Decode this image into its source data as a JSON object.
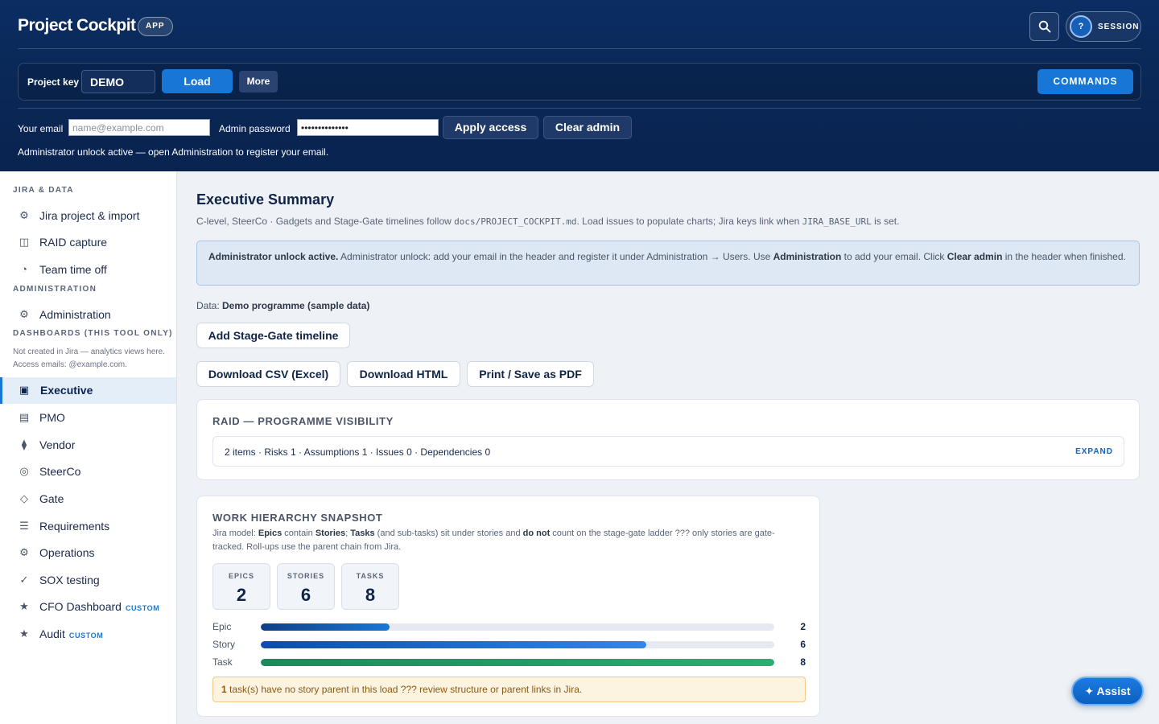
{
  "header": {
    "brand": "Project Cockpit",
    "app_badge": "APP",
    "session_initial": "?",
    "session_label": "SESSION",
    "toolbar": {
      "project_key_label": "Project key",
      "project_key_value": "DEMO",
      "load": "Load",
      "more": "More",
      "commands": "COMMANDS"
    },
    "access": {
      "email_label": "Your email",
      "email_placeholder": "name@example.com",
      "password_label": "Admin password",
      "password_value": "••••••••••••••",
      "apply": "Apply access",
      "clear": "Clear admin",
      "note": "Administrator unlock active — open Administration to register your email."
    }
  },
  "sidebar": {
    "sections": {
      "jira_data": "JIRA & DATA",
      "administration": "ADMINISTRATION",
      "dashboards": "DASHBOARDS (THIS TOOL ONLY)"
    },
    "dashboards_note": "Not created in Jira — analytics views here. Access emails: @example.com.",
    "items": [
      {
        "label": "Jira project & import",
        "icon": "gear-icon"
      },
      {
        "label": "RAID capture",
        "icon": "grid-icon"
      },
      {
        "label": "Team time off",
        "icon": "clock-icon"
      },
      {
        "label": "Administration",
        "icon": "gear-icon"
      },
      {
        "label": "Executive",
        "icon": "card-icon"
      },
      {
        "label": "PMO",
        "icon": "table-icon"
      },
      {
        "label": "Vendor",
        "icon": "diamond-icon"
      },
      {
        "label": "SteerCo",
        "icon": "target-icon"
      },
      {
        "label": "Gate",
        "icon": "diamond-outline-icon"
      },
      {
        "label": "Requirements",
        "icon": "list-icon"
      },
      {
        "label": "Operations",
        "icon": "gear-icon"
      },
      {
        "label": "SOX testing",
        "icon": "check-icon"
      },
      {
        "label": "CFO Dashboard",
        "icon": "star-icon",
        "tag": "CUSTOM"
      },
      {
        "label": "Audit",
        "icon": "star-icon",
        "tag": "CUSTOM"
      }
    ]
  },
  "main": {
    "title": "Executive Summary",
    "subtitle": {
      "p1": "C-level, SteerCo · Gadgets and Stage-Gate timelines follow ",
      "code1": "docs/PROJECT_COCKPIT.md",
      "p2": ". Load issues to populate charts; Jira keys link when ",
      "code2": "JIRA_BASE_URL",
      "p3": " is set."
    },
    "info": {
      "strong1": "Administrator unlock active.",
      "t1": " Administrator unlock: add your email in the header and register it under Administration → Users. Use ",
      "strong2": "Administration",
      "t2": " to add your email. Click ",
      "strong3": "Clear admin",
      "t3": " in the header when finished."
    },
    "data_label": "Data: ",
    "data_value": "Demo programme (sample data)",
    "buttons": {
      "add_stage_gate": "Add Stage-Gate timeline",
      "download_csv": "Download CSV (Excel)",
      "download_html": "Download HTML",
      "print_pdf": "Print / Save as PDF"
    },
    "raid": {
      "title": "RAID — PROGRAMME VISIBILITY",
      "summary": "2 items · Risks 1 · Assumptions 1 · Issues 0 · Dependencies 0",
      "expand": "EXPAND"
    },
    "work": {
      "title": "WORK HIERARCHY SNAPSHOT",
      "desc": {
        "t0": "Jira model: ",
        "b1": "Epics",
        "t1": " contain ",
        "b2": "Stories",
        "t2": "; ",
        "b3": "Tasks",
        "t3": " (and sub-tasks) sit under stories and ",
        "b4": "do not",
        "t4": " count on the stage-gate ladder ??? only stories are gate-tracked. Roll-ups use the parent chain from Jira."
      },
      "stats": [
        {
          "label": "EPICS",
          "value": "2"
        },
        {
          "label": "STORIES",
          "value": "6"
        },
        {
          "label": "TASKS",
          "value": "8"
        }
      ],
      "bars": [
        {
          "label": "Epic",
          "value": 2,
          "color_from": "#0f3f86",
          "color_to": "#1877d6"
        },
        {
          "label": "Story",
          "value": 6,
          "color_from": "#0f4bb0",
          "color_to": "#2f86f0"
        },
        {
          "label": "Task",
          "value": 8,
          "color_from": "#1a8a5a",
          "color_to": "#2aae72"
        }
      ],
      "bar_max": 8,
      "warning_count": "1",
      "warning_text": " task(s) have no story parent in this load ??? review structure or parent links in Jira."
    }
  },
  "assist": "Assist"
}
